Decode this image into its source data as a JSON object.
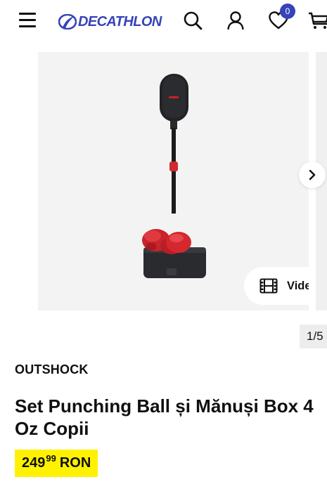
{
  "header": {
    "logo_text": "DECATHLON",
    "wishlist_count": "0",
    "icons": [
      "menu-icon",
      "search-icon",
      "account-icon",
      "heart-icon",
      "cart-icon"
    ]
  },
  "gallery": {
    "video_label": "Video",
    "counter": "1/5"
  },
  "product": {
    "brand": "OUTSHOCK",
    "title": "Set Punching Ball și Mănuși Box 4 Oz Copii",
    "price": {
      "integer": "249",
      "decimals": "99",
      "currency": "RON"
    }
  },
  "colors": {
    "brand_blue": "#3643ba",
    "price_highlight": "#fff200",
    "image_bg": "#f3f3f3",
    "glove_red": "#d6202b"
  }
}
